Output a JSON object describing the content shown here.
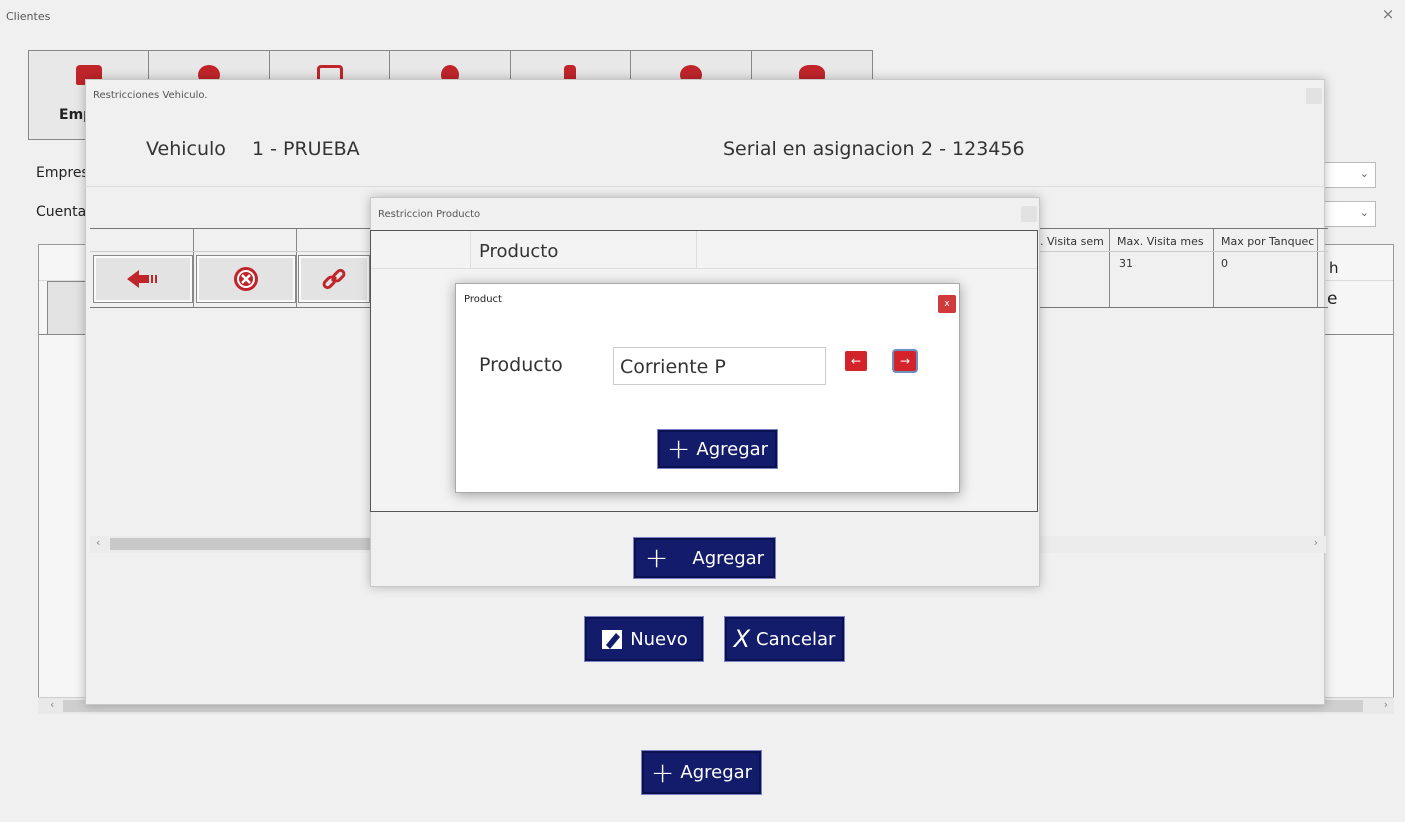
{
  "window": {
    "title": "Clientes",
    "close_glyph": "×"
  },
  "tabs": [
    {
      "icon": "briefcase-icon",
      "label": "Emp"
    },
    {
      "icon": "tab-icon-2",
      "label": ""
    },
    {
      "icon": "tab-icon-3",
      "label": ""
    },
    {
      "icon": "tab-icon-4",
      "label": ""
    },
    {
      "icon": "tab-icon-5",
      "label": ""
    },
    {
      "icon": "tab-icon-6",
      "label": ""
    },
    {
      "icon": "tab-icon-7",
      "label": ""
    }
  ],
  "form": {
    "empresa_label": "Empres",
    "cuenta_label": "Cuenta",
    "combo_arrow": "⌄"
  },
  "background_table": {
    "partial_header_1": "h",
    "partial_header_2": "e"
  },
  "scroll": {
    "left": "‹",
    "right": "›"
  },
  "restricciones_dialog": {
    "title": "Restricciones Vehiculo.",
    "vehiculo_label": "Vehiculo",
    "vehiculo_value": "1 - PRUEBA",
    "serial_label": "Serial en asignacion",
    "serial_value": "2 - 123456",
    "columns": [
      ". Visita sem",
      "Max. Visita mes",
      "Max por Tanquec"
    ],
    "row": {
      "visita_mes": "31",
      "max_tanqueo": "0"
    },
    "nuevo_label": "Nuevo",
    "cancelar_label": "Cancelar",
    "cancelar_glyph": "X"
  },
  "producto_dialog": {
    "title": "Restriccion Producto",
    "column_header": "Producto",
    "agregar_label": "Agregar"
  },
  "product_dialog": {
    "title": "Product",
    "close_glyph": "x",
    "field_label": "Producto",
    "field_value": "Corriente P",
    "agregar_label": "Agregar"
  },
  "main_agregar_label": "Agregar",
  "colors": {
    "navy": "#131c6b",
    "red": "#d4242b",
    "icon_red": "#c0252a"
  }
}
